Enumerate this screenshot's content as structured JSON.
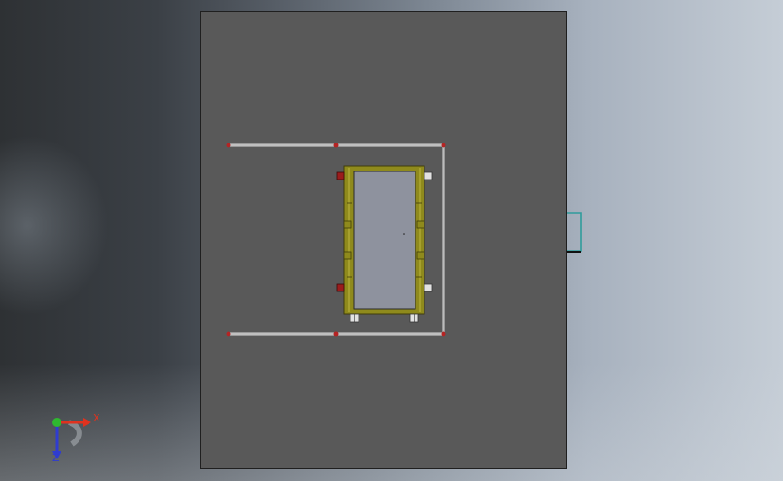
{
  "viewport": {
    "background_colors": [
      "#2e3134",
      "#c5cdd6"
    ]
  },
  "model": {
    "plate_color": "#595959",
    "frame_color": "#8f8a1c",
    "panel_color": "#8e929e",
    "pin_color": "#9b1c1c",
    "rail_color": "#d8d8d8",
    "bracket_color": "#2f9c9c"
  },
  "triad": {
    "x_label": "X",
    "z_label": "Z",
    "x_color": "#e0321e",
    "y_color": "#2fb82f",
    "z_color": "#2f3cd0"
  }
}
